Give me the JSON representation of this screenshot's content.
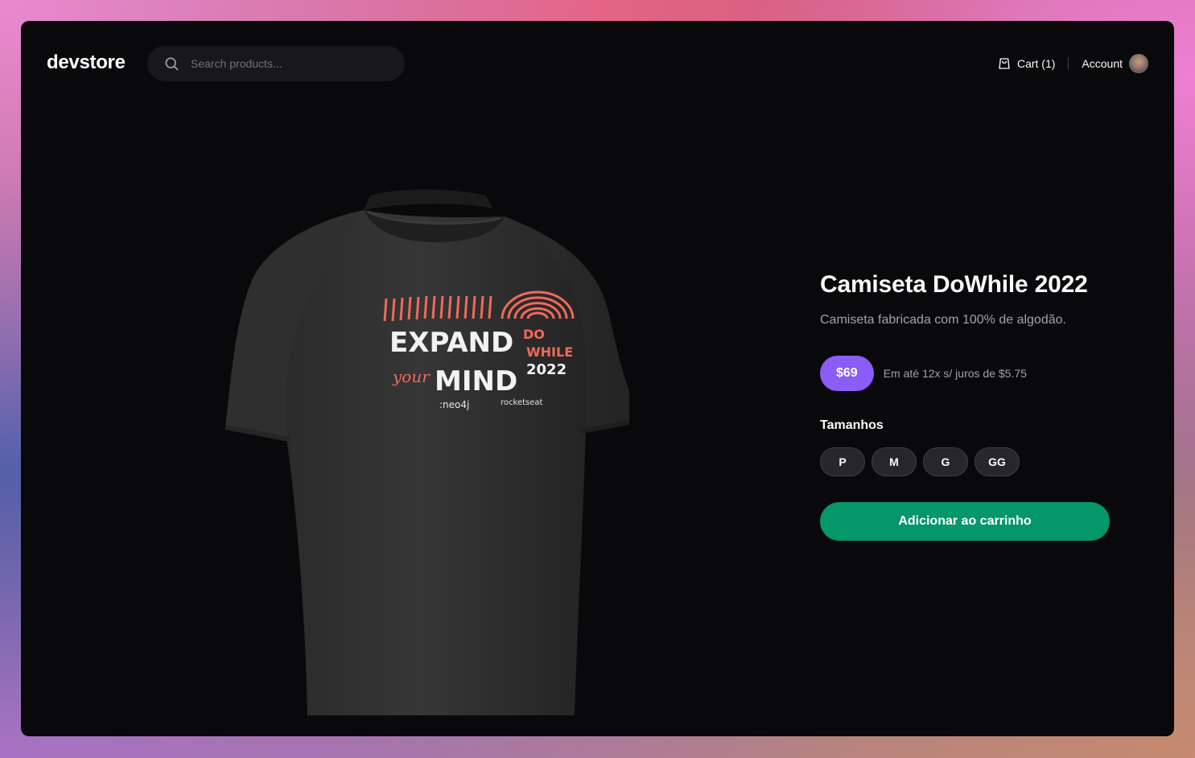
{
  "header": {
    "logo": "devstore",
    "search": {
      "placeholder": "Search products..."
    },
    "cart_label": "Cart (1)",
    "account_label": "Account"
  },
  "product": {
    "title": "Camiseta DoWhile 2022",
    "description": "Camiseta fabricada com 100% de algodão.",
    "price": "$69",
    "installments": "Em até 12x s/ juros de $5.75",
    "sizes_label": "Tamanhos",
    "sizes": [
      "P",
      "M",
      "G",
      "GG"
    ],
    "add_to_cart_label": "Adicionar ao carrinho",
    "image": {
      "print_line1": "EXPAND",
      "print_your": "your",
      "print_line2": "MIND",
      "print_do": "DO",
      "print_while": "WHILE",
      "print_year": "2022",
      "sponsor1": ":neo4j",
      "sponsor2": "rocketseat"
    }
  },
  "colors": {
    "background": "#09090b",
    "accent_price": "#8b5cf6",
    "add_button": "#059669",
    "print_coral": "#f06a5a"
  }
}
